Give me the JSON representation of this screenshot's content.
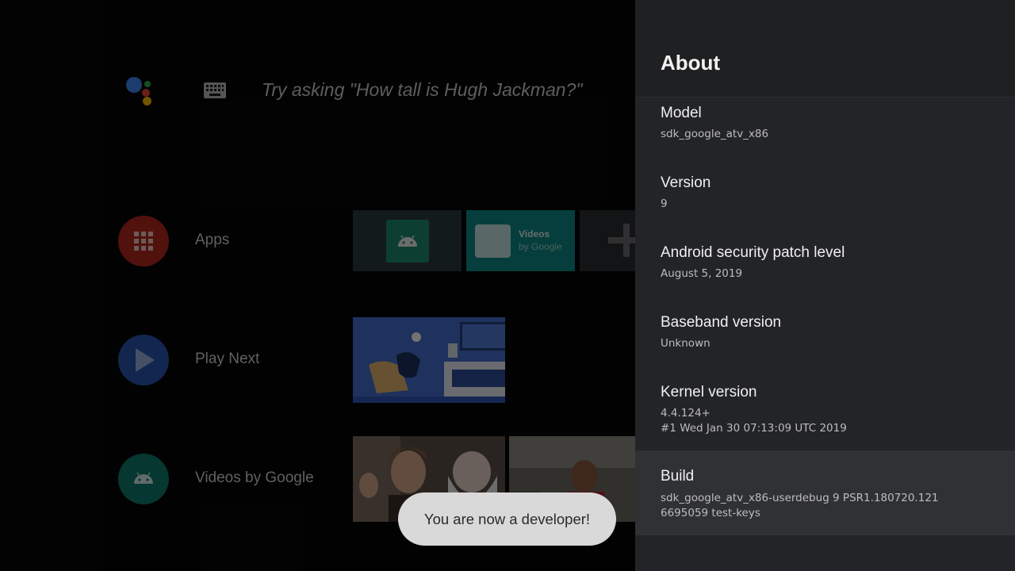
{
  "colors": {
    "panel_bg": "#232427",
    "panel_header_bg": "#1f2022",
    "selected_item_bg": "#303134",
    "toast_bg": "#d9d9d9",
    "apps_icon": "#b3261e",
    "play_next_icon": "#2b55b0",
    "videos_icon": "#0f7a6e"
  },
  "home": {
    "assistant_prompt": "Try asking \"How tall is Hugh Jackman?\"",
    "icons": {
      "assistant": "google-assistant-dots-icon",
      "keyboard": "keyboard-icon"
    },
    "rows": [
      {
        "label": "Apps",
        "icon": "apps-grid-icon"
      },
      {
        "label": "Play Next",
        "icon": "play-icon"
      },
      {
        "label": "Videos by Google",
        "icon": "android-icon"
      }
    ],
    "app_tiles": {
      "videos_tile_line1": "Videos",
      "videos_tile_line2": "by Google",
      "add_tile_icon": "plus-icon"
    }
  },
  "about_panel": {
    "title": "About",
    "items": [
      {
        "title": "Model",
        "value": "sdk_google_atv_x86"
      },
      {
        "title": "Version",
        "value": "9"
      },
      {
        "title": "Android security patch level",
        "value": "August 5, 2019"
      },
      {
        "title": "Baseband version",
        "value": "Unknown"
      },
      {
        "title": "Kernel version",
        "value_line1": "4.4.124+",
        "value_line2": "#1 Wed Jan 30 07:13:09 UTC 2019"
      },
      {
        "title": "Build",
        "value_line1": "sdk_google_atv_x86-userdebug 9 PSR1.180720.121",
        "value_line2": "6695059 test-keys"
      }
    ]
  },
  "toast": {
    "message": "You are now a developer!"
  }
}
